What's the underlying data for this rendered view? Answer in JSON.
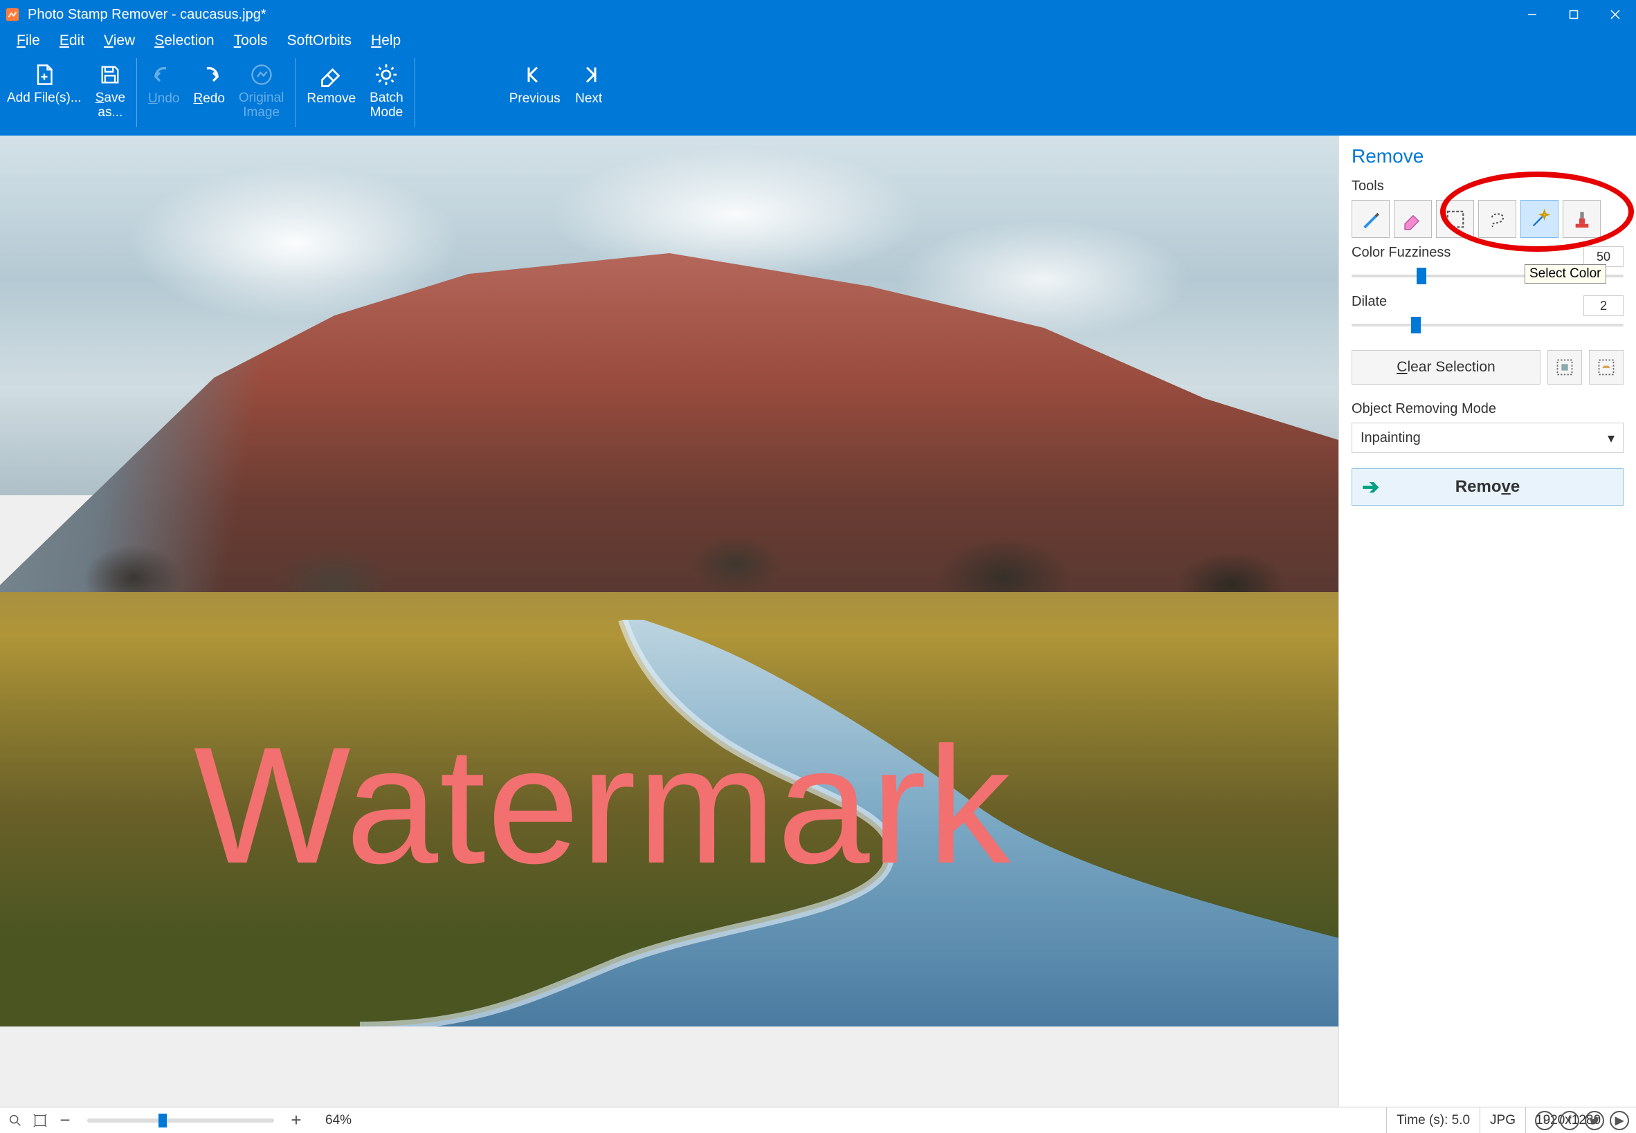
{
  "title": "Photo Stamp Remover - caucasus.jpg*",
  "menu": {
    "file": "File",
    "edit": "Edit",
    "view": "View",
    "selection": "Selection",
    "tools": "Tools",
    "softorbits": "SoftOrbits",
    "help": "Help"
  },
  "ribbon": {
    "addfiles": "Add File(s)...",
    "saveas": "Save as...",
    "undo": "Undo",
    "redo": "Redo",
    "original": "Original Image",
    "remove": "Remove",
    "batch": "Batch Mode",
    "previous": "Previous",
    "next": "Next"
  },
  "watermark_text": "Watermark",
  "side": {
    "heading": "Remove",
    "tools_label": "Tools",
    "color_fuzziness_label": "Color Fuzziness",
    "color_fuzziness_value": "50",
    "color_fuzziness_pos_pct": 24,
    "dilate_label": "Dilate",
    "dilate_value": "2",
    "dilate_pos_pct": 22,
    "clear_selection": "Clear Selection",
    "mode_label": "Object Removing Mode",
    "mode_value": "Inpainting",
    "remove_button": "Remove",
    "tooltip": "Select Color"
  },
  "status": {
    "zoom_pct": "64%",
    "zoom_pos_pct": 38,
    "time": "Time (s): 5.0",
    "format": "JPG",
    "dims": "1920x1280"
  }
}
